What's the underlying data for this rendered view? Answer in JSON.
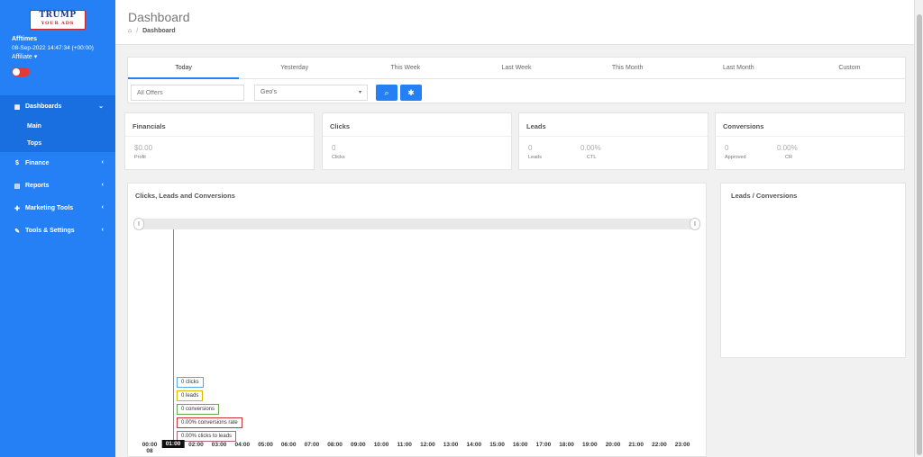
{
  "sidebar": {
    "logo": {
      "line1": "TRUMP",
      "line2": "YOUR ADS"
    },
    "user": {
      "name": "Afftimes",
      "datetime": "08-Sep-2022 14:47:34 (+00:00)",
      "role": "Affiliate ▾"
    },
    "items": [
      {
        "label": "Dashboards",
        "icon": "dashboard-icon",
        "glyph": "▦",
        "chevron": "⌄"
      },
      {
        "label": "Main"
      },
      {
        "label": "Tops"
      },
      {
        "label": "Finance",
        "icon": "dollar-icon",
        "glyph": "$",
        "chevron": "‹"
      },
      {
        "label": "Reports",
        "icon": "file-icon",
        "glyph": "▤",
        "chevron": "‹"
      },
      {
        "label": "Marketing Tools",
        "icon": "puzzle-icon",
        "glyph": "✚",
        "chevron": "‹"
      },
      {
        "label": "Tools & Settings",
        "icon": "wrench-icon",
        "glyph": "✎",
        "chevron": "‹"
      }
    ]
  },
  "header": {
    "title": "Dashboard",
    "breadcrumb": {
      "home_glyph": "⌂",
      "sep": "/",
      "current": "Dashboard"
    }
  },
  "filters": {
    "tabs": [
      "Today",
      "Yesterday",
      "This Week",
      "Last Week",
      "This Month",
      "Last Month",
      "Custom"
    ],
    "active_tab": "Today",
    "offers_placeholder": "All Offers",
    "geo_value": "Geo's",
    "geo_caret": "▾",
    "search_glyph": "⌕",
    "settings_glyph": "✱"
  },
  "stats": {
    "financials": {
      "title": "Financials",
      "value": "$0.00",
      "label": "Profit"
    },
    "clicks": {
      "title": "Clicks",
      "value": "0",
      "label": "Clicks"
    },
    "leads": {
      "title": "Leads",
      "v1": "0",
      "l1": "Leads",
      "v2": "0.00%",
      "l2": "CTL"
    },
    "conversions": {
      "title": "Conversions",
      "v1": "0",
      "l1": "Approved",
      "v2": "0.00%",
      "l2": "CR"
    }
  },
  "chart": {
    "title": "Clicks, Leads and Conversions",
    "handle_glyph": "||",
    "tooltips": [
      {
        "text": "0 clicks",
        "color": "#5aa9e6"
      },
      {
        "text": "0 leads",
        "color": "#d4b800"
      },
      {
        "text": "0 conversions",
        "color": "#6aa84f"
      },
      {
        "text": "0.00% conversions rate",
        "color": "#cc3333"
      },
      {
        "text": "0.00% clicks to leads",
        "color": "#b2628a"
      }
    ],
    "x_first_line1": "00:00",
    "x_first_line2": "08",
    "x_highlight": "01:00"
  },
  "pie": {
    "title": "Leads / Conversions"
  },
  "chart_data": {
    "type": "line",
    "title": "Clicks, Leads and Conversions",
    "x": [
      "00:00",
      "01:00",
      "02:00",
      "03:00",
      "04:00",
      "05:00",
      "06:00",
      "07:00",
      "08:00",
      "09:00",
      "10:00",
      "11:00",
      "12:00",
      "13:00",
      "14:00",
      "15:00",
      "16:00",
      "17:00",
      "18:00",
      "19:00",
      "20:00",
      "21:00",
      "22:00",
      "23:00"
    ],
    "series": [
      {
        "name": "clicks",
        "values": [
          0,
          0,
          0,
          0,
          0,
          0,
          0,
          0,
          0,
          0,
          0,
          0,
          0,
          0,
          0,
          0,
          0,
          0,
          0,
          0,
          0,
          0,
          0,
          0
        ]
      },
      {
        "name": "leads",
        "values": [
          0,
          0,
          0,
          0,
          0,
          0,
          0,
          0,
          0,
          0,
          0,
          0,
          0,
          0,
          0,
          0,
          0,
          0,
          0,
          0,
          0,
          0,
          0,
          0
        ]
      },
      {
        "name": "conversions",
        "values": [
          0,
          0,
          0,
          0,
          0,
          0,
          0,
          0,
          0,
          0,
          0,
          0,
          0,
          0,
          0,
          0,
          0,
          0,
          0,
          0,
          0,
          0,
          0,
          0
        ]
      }
    ],
    "grid": false
  }
}
